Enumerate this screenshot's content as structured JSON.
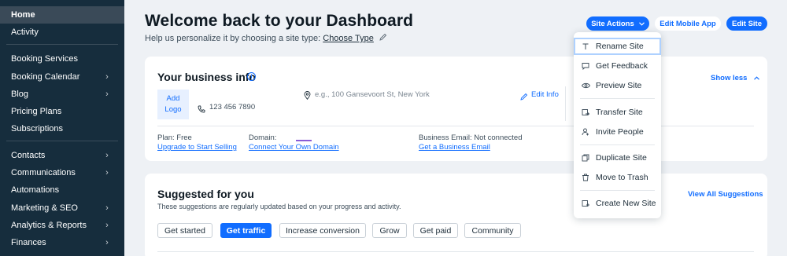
{
  "sidebar": {
    "items": [
      {
        "label": "Home",
        "chevron": false,
        "active": true
      },
      {
        "label": "Activity",
        "chevron": false
      },
      {
        "label": "Booking Services",
        "chevron": false
      },
      {
        "label": "Booking Calendar",
        "chevron": true
      },
      {
        "label": "Blog",
        "chevron": true
      },
      {
        "label": "Pricing Plans",
        "chevron": false
      },
      {
        "label": "Subscriptions",
        "chevron": false
      },
      {
        "label": "Contacts",
        "chevron": true
      },
      {
        "label": "Communications",
        "chevron": true
      },
      {
        "label": "Automations",
        "chevron": false
      },
      {
        "label": "Marketing & SEO",
        "chevron": true
      },
      {
        "label": "Analytics & Reports",
        "chevron": true
      },
      {
        "label": "Finances",
        "chevron": true
      }
    ]
  },
  "header": {
    "title": "Welcome back to your Dashboard",
    "subtitle_prefix": "Help us personalize it by choosing a site type:",
    "subtitle_link": "Choose Type",
    "site_actions_label": "Site Actions",
    "edit_mobile_label": "Edit Mobile App",
    "edit_site_label": "Edit Site"
  },
  "business_info": {
    "title": "Your business info",
    "add_logo_line1": "Add",
    "add_logo_line2": "Logo",
    "phone": "123 456 7890",
    "address_placeholder": "e.g., 100 Gansevoort St, New York",
    "edit_info": "Edit Info",
    "show_less": "Show less",
    "plan_label": "Plan: Free",
    "plan_link": "Upgrade to Start Selling",
    "domain_label": "Domain:",
    "domain_link": "Connect Your Own Domain",
    "email_label": "Business Email: Not connected",
    "email_link": "Get a Business Email"
  },
  "suggestions": {
    "title": "Suggested for you",
    "subtitle": "These suggestions are regularly updated based on your progress and activity.",
    "view_all": "View All Suggestions",
    "chips": [
      "Get started",
      "Get traffic",
      "Increase conversion",
      "Grow",
      "Get paid",
      "Community"
    ],
    "selected_chip": "Get traffic"
  },
  "site_actions_menu": {
    "items": [
      {
        "label": "Rename Site",
        "icon": "text-icon"
      },
      {
        "label": "Get Feedback",
        "icon": "chat-bubble-icon"
      },
      {
        "label": "Preview Site",
        "icon": "eye-icon"
      },
      {
        "label": "Transfer Site",
        "icon": "transfer-icon"
      },
      {
        "label": "Invite People",
        "icon": "person-add-icon"
      },
      {
        "label": "Duplicate Site",
        "icon": "duplicate-icon"
      },
      {
        "label": "Move to Trash",
        "icon": "trash-icon"
      },
      {
        "label": "Create New Site",
        "icon": "new-site-icon"
      }
    ]
  },
  "colors": {
    "sidebar_bg": "#162d3d",
    "accent": "#116dff",
    "page_bg": "#eef1f5"
  }
}
